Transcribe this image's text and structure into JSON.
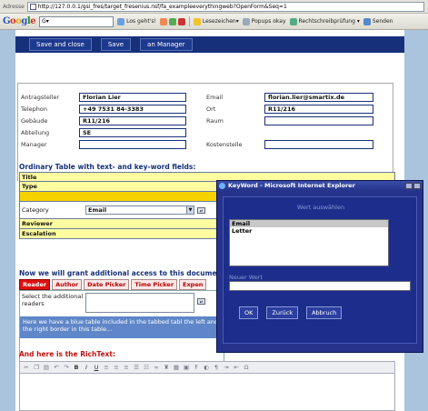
{
  "browser": {
    "address_label": "Adresse",
    "url": "http://127.0.0.1/gsi_fres/target_fresenius.nsf/fa_exampleeverythingweb?OpenForm&Seq=1"
  },
  "google_toolbar": {
    "logo_parts": [
      "G",
      "o",
      "o",
      "g",
      "l",
      "e"
    ],
    "search_value": "G▾",
    "go_label": "Los geht's!",
    "bookmarks_label": "Lesezeichen▾",
    "popups_label": "Popups okay",
    "spellcheck_label": "Rechtschreibprüfung ▾",
    "send_label": "Senden"
  },
  "actions": {
    "save_close": "Save and close",
    "save": "Save",
    "manager": "an Manager"
  },
  "header_fields": {
    "antragsteller_label": "Antragsteller",
    "antragsteller_value": "Florian Lier",
    "telephon_label": "Telephon",
    "telephon_value": "+49 7531 84-3383",
    "gebaeude_label": "Gebäude",
    "gebaeude_value": "R11/216",
    "abteilung_label": "Abteilung",
    "abteilung_value": "SE",
    "manager_label": "Manager",
    "manager_value": "",
    "email_label": "Email",
    "email_value": "florian.lier@smartix.de",
    "ort_label": "Ort",
    "ort_value": "R11/216",
    "raum_label": "Raum",
    "raum_value": "",
    "kostenstelle_label": "Kostenstelle",
    "kostenstelle_value": ""
  },
  "ordinary_table": {
    "title": "Ordinary Table with text- and key-word fields:",
    "row_title": "Title",
    "row_type": "Type",
    "row_highlight": "",
    "category_label": "Category",
    "category_value": "Email",
    "row_reviewer": "Reviewer",
    "row_escalation": "Escalation"
  },
  "access": {
    "title": "Now we will grant additional access to this docume",
    "tabs": [
      "Reader",
      "Author",
      "Date Picker",
      "Time Picker",
      "Expen"
    ],
    "readers_label": "Select the additional readers",
    "blue_text": "Here we have a blue table included in the tabbed tabl the left and the right border in this table..."
  },
  "richtext": {
    "title": "And here is the RichText:"
  },
  "dialog": {
    "title": "KeyWord - Microsoft Internet Explorer",
    "heading": "Wert auswählen",
    "options": [
      "Email",
      "Letter"
    ],
    "new_value_label": "Neuer Wert",
    "new_value": "",
    "ok": "OK",
    "back": "Zurück",
    "cancel": "Abbruch"
  }
}
